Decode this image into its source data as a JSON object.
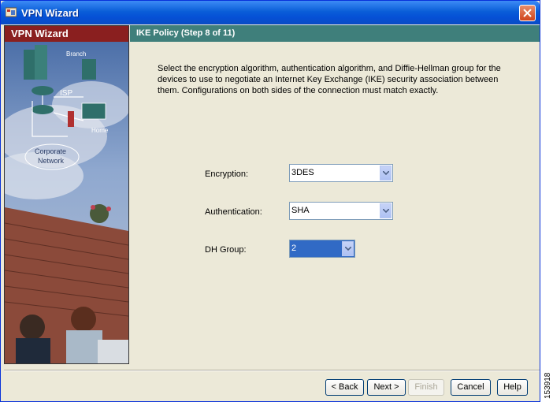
{
  "window": {
    "title": "VPN Wizard"
  },
  "left_panel": {
    "header": "VPN Wizard",
    "art_labels": {
      "branch": "Branch",
      "isp": "ISP",
      "home": "Home",
      "corporate": "Corporate",
      "network": "Network"
    }
  },
  "step": {
    "title": "IKE Policy  (Step 8 of 11)"
  },
  "description": "Select the encryption algorithm, authentication algorithm, and Diffie-Hellman group for the devices to use to negotiate an Internet Key Exchange (IKE) security association between them. Configurations on both sides of the connection must match exactly.",
  "fields": {
    "encryption": {
      "label": "Encryption:",
      "value": "3DES"
    },
    "authentication": {
      "label": "Authentication:",
      "value": "SHA"
    },
    "dh_group": {
      "label": "DH Group:",
      "value": "2"
    }
  },
  "buttons": {
    "back": "< Back",
    "next": "Next >",
    "finish": "Finish",
    "cancel": "Cancel",
    "help": "Help"
  },
  "figure_number": "153918",
  "colors": {
    "title_bar": "#0a5ed8",
    "left_header": "#8a1f1f",
    "step_header": "#3f7f7b",
    "selection": "#316ac5"
  }
}
